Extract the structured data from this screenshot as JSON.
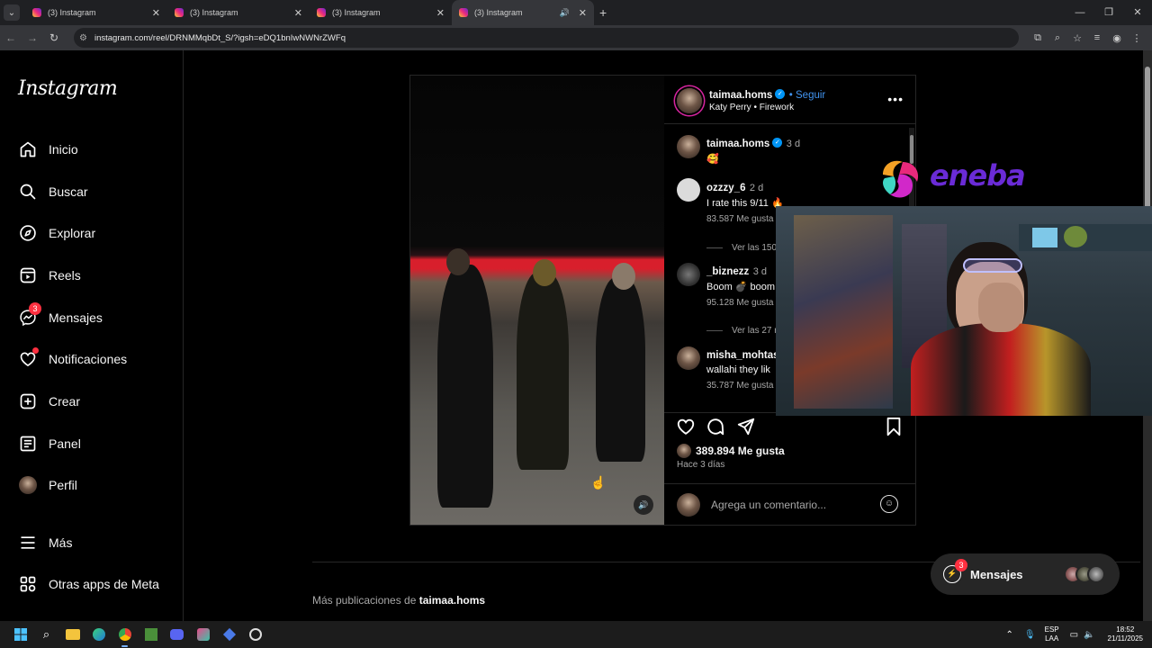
{
  "browser": {
    "tabs": [
      {
        "title": "(3) Instagram",
        "active": false
      },
      {
        "title": "(3) Instagram",
        "active": false
      },
      {
        "title": "(3) Instagram",
        "active": false
      },
      {
        "title": "(3) Instagram",
        "active": true
      }
    ],
    "url": "instagram.com/reel/DRNMMqbDt_S/?igsh=eDQ1bnIwNWNrZWFq"
  },
  "sidebar": {
    "logo": "Instagram",
    "items": [
      {
        "label": "Inicio",
        "icon": "home-icon"
      },
      {
        "label": "Buscar",
        "icon": "search-icon"
      },
      {
        "label": "Explorar",
        "icon": "compass-icon"
      },
      {
        "label": "Reels",
        "icon": "reels-icon"
      },
      {
        "label": "Mensajes",
        "icon": "messenger-icon",
        "badge": "3"
      },
      {
        "label": "Notificaciones",
        "icon": "heart-icon"
      },
      {
        "label": "Crear",
        "icon": "plus-square-icon"
      },
      {
        "label": "Panel",
        "icon": "dashboard-icon"
      },
      {
        "label": "Perfil",
        "icon": "avatar"
      },
      {
        "label": "Más",
        "icon": "menu-icon"
      },
      {
        "label": "Otras apps de Meta",
        "icon": "apps-icon"
      }
    ]
  },
  "post": {
    "author": "taimaa.homs",
    "follow_label": "Seguir",
    "audio": "Katy Perry • Firework",
    "caption": {
      "user": "taimaa.homs",
      "time": "3 d",
      "text": "🥰"
    },
    "comments": [
      {
        "user": "ozzzy_6",
        "time": "2 d",
        "text": "I rate this 9/11 🔥",
        "likes": "83.587 Me gusta",
        "replies": "Ver las 150"
      },
      {
        "user": "_biznezz",
        "time": "3 d",
        "text": "Boom 💣 boom",
        "likes": "95.128 Me gusta",
        "replies": "Ver las 27 r"
      },
      {
        "user": "misha_mohtasc",
        "time": "",
        "text": "wallahi they lik",
        "likes": "35.787 Me gusta",
        "replies": ""
      }
    ],
    "like_count": "389.894 Me gusta",
    "posted_ago": "Hace 3 días",
    "comment_placeholder": "Agrega un comentario..."
  },
  "more_posts": {
    "prefix": "Más publicaciones de ",
    "user": "taimaa.homs"
  },
  "messages_bar": {
    "label": "Mensajes",
    "badge": "3"
  },
  "overlay": {
    "brand": "eneba"
  },
  "taskbar": {
    "lang_top": "ESP",
    "lang_bottom": "LAA",
    "time": "18:52",
    "date": "21/11/2025"
  },
  "colors": {
    "accent": "#0095f6",
    "follow": "#4193ef",
    "badge": "#ff3040",
    "eneba": "#6a2bd6"
  }
}
